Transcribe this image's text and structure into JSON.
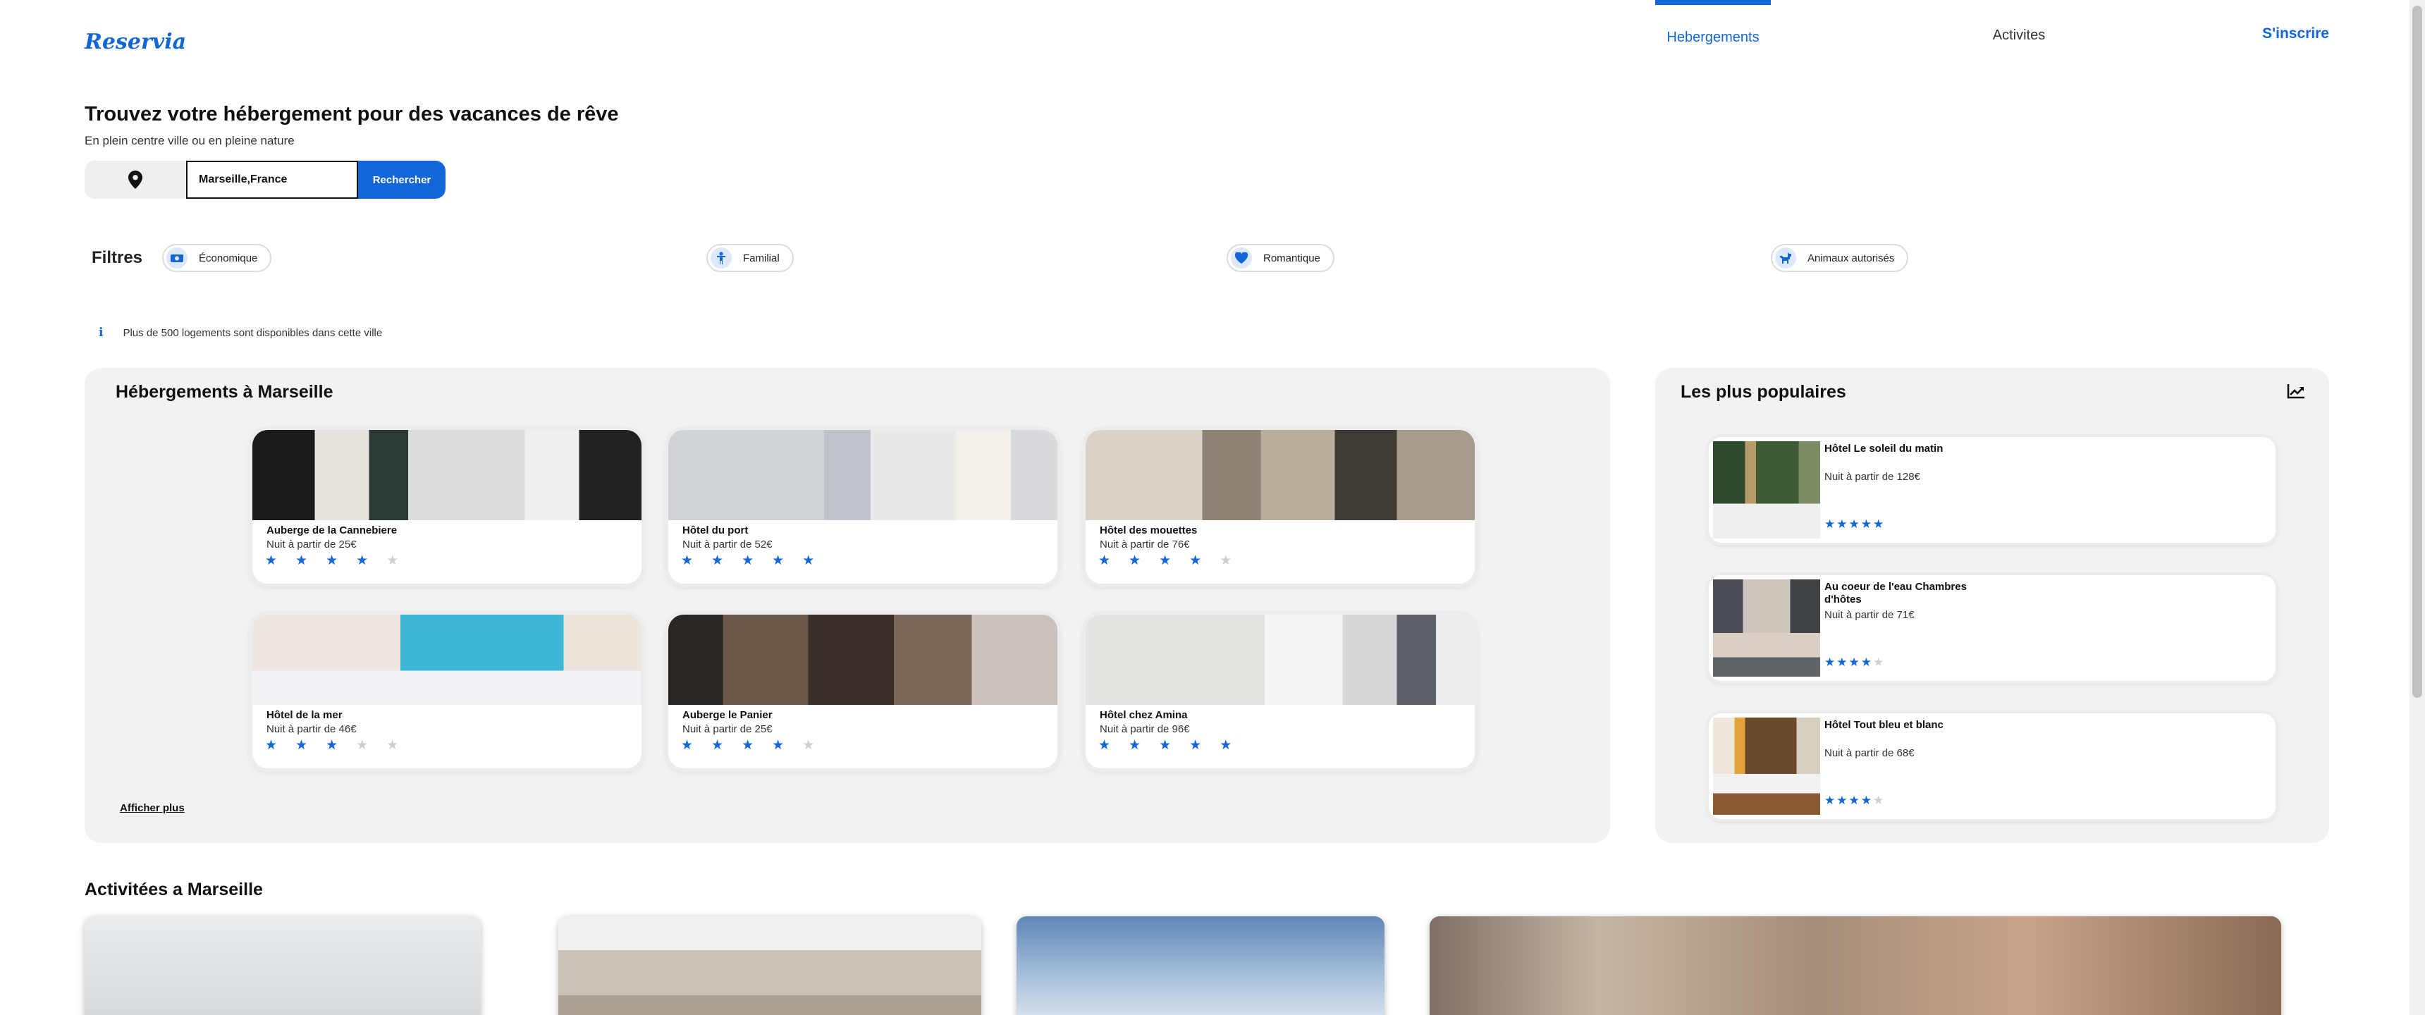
{
  "app": {
    "brand": "Reservia"
  },
  "nav": {
    "items": [
      {
        "label": "Hebergements"
      },
      {
        "label": "Activites"
      }
    ],
    "signup": "S'inscrire"
  },
  "hero": {
    "title": "Trouvez votre hébergement pour des vacances de rêve",
    "subtitle": "En plein centre ville ou en pleine nature",
    "search_value": "Marseille,France",
    "search_button": "Rechercher"
  },
  "filters": {
    "label": "Filtres",
    "items": [
      {
        "label": "Économique",
        "icon": "money-icon"
      },
      {
        "label": "Familial",
        "icon": "child-icon"
      },
      {
        "label": "Romantique",
        "icon": "heart-icon"
      },
      {
        "label": "Animaux autorisés",
        "icon": "dog-icon"
      }
    ]
  },
  "info": {
    "text": "Plus de 500 logements sont disponibles dans cette ville"
  },
  "lodging": {
    "title": "Hébergements à Marseille",
    "more": "Afficher plus",
    "cards": [
      {
        "name": "Auberge de la Cannebiere",
        "price": "Nuit à partir de 25€",
        "rating": 4
      },
      {
        "name": "Hôtel du port",
        "price": "Nuit à partir de 52€",
        "rating": 5
      },
      {
        "name": "Hôtel des mouettes",
        "price": "Nuit à partir de 76€",
        "rating": 4
      },
      {
        "name": "Hôtel de la mer",
        "price": "Nuit à partir de 46€",
        "rating": 3
      },
      {
        "name": "Auberge le Panier",
        "price": "Nuit à partir de 25€",
        "rating": 4
      },
      {
        "name": "Hôtel chez Amina",
        "price": "Nuit à partir de 96€",
        "rating": 5
      }
    ]
  },
  "popular": {
    "title": "Les plus populaires",
    "cards": [
      {
        "name": "Hôtel Le soleil du matin",
        "price": "Nuit à partir de 128€",
        "rating": 5
      },
      {
        "name": "Au coeur de l'eau Chambres d'hôtes",
        "price": "Nuit à partir de 71€",
        "rating": 4
      },
      {
        "name": "Hôtel Tout bleu et blanc",
        "price": "Nuit à partir de 68€",
        "rating": 4
      }
    ]
  },
  "activities": {
    "title": "Activitées a Marseille"
  },
  "colors": {
    "accent": "#1266d8",
    "panel": "#f2f2f2",
    "star_off": "#cfcfcf"
  }
}
